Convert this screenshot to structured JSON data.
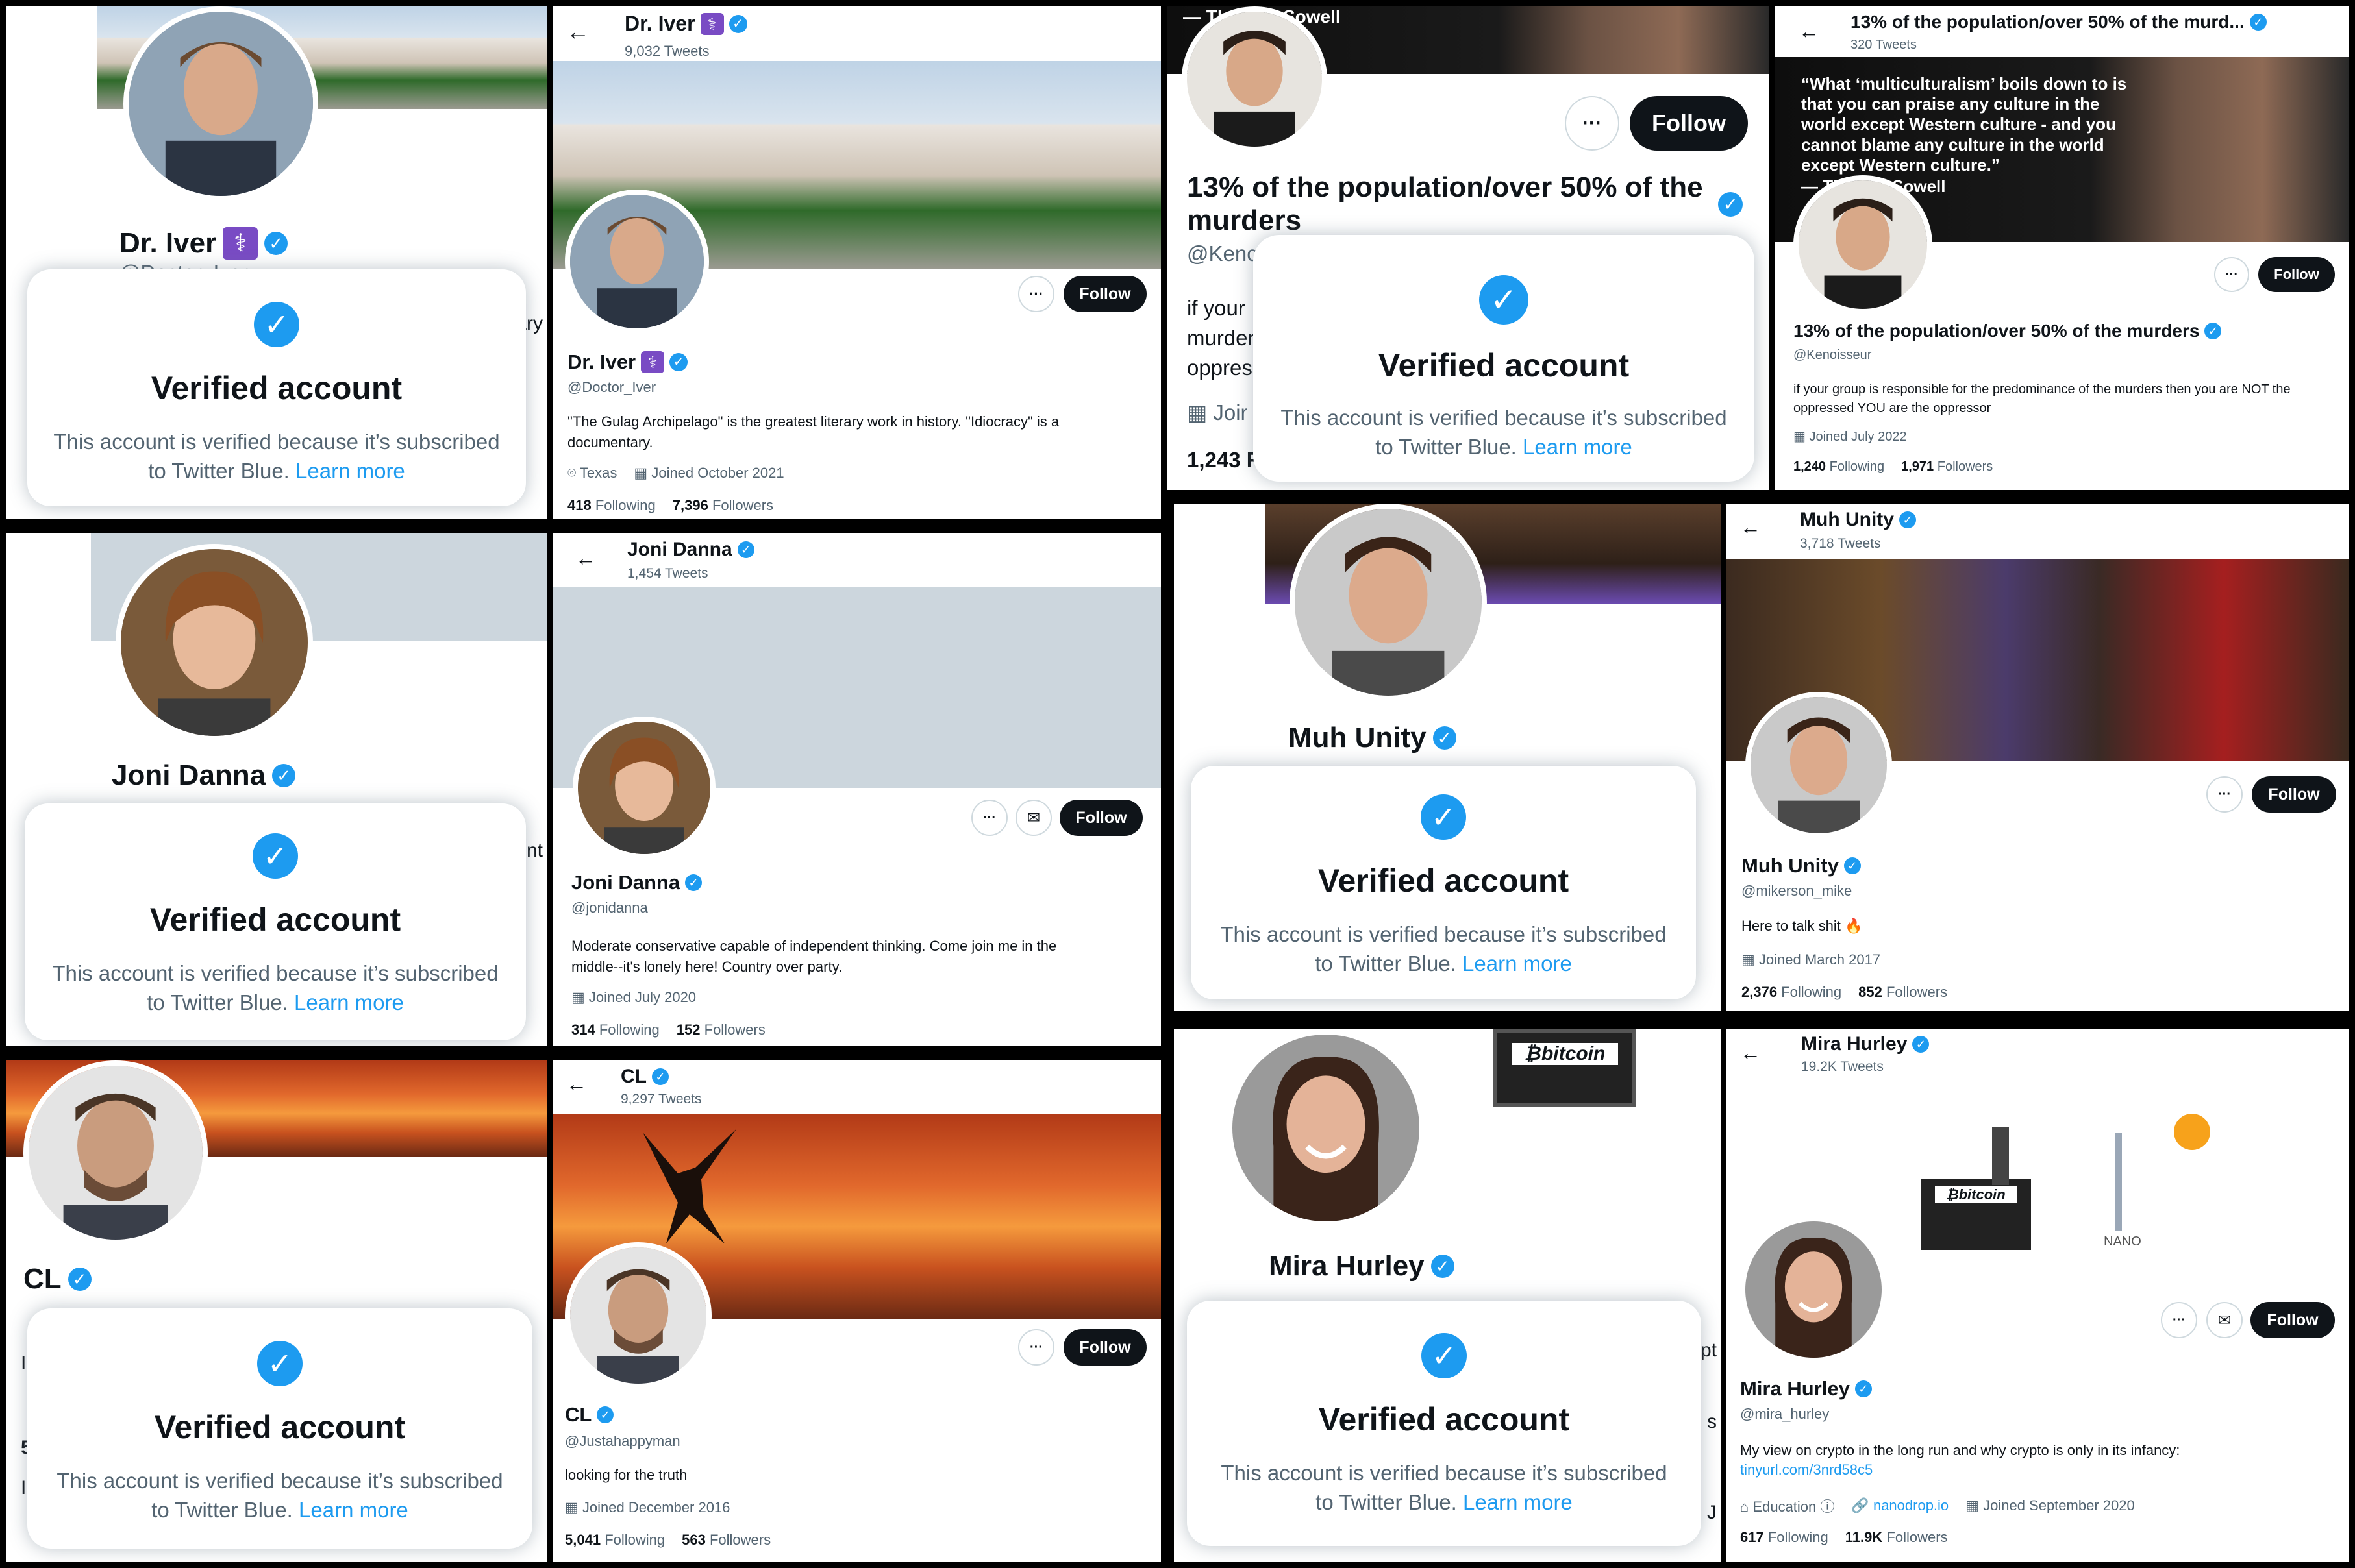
{
  "colors": {
    "accent": "#1d9bf0",
    "follow_bg": "#0f1419",
    "medical_badge": "#794bc4"
  },
  "icons": {
    "verified": "verified-badge-icon",
    "back": "back-arrow-icon",
    "more": "more-icon",
    "message": "message-icon",
    "calendar": "calendar-icon",
    "location": "location-icon",
    "link": "link-icon"
  },
  "glyphs": {
    "check": "✓",
    "back": "←",
    "more": "···",
    "mail": "✉",
    "med": "⚕",
    "pin": "⌾",
    "cal": "▦",
    "link": "🔗",
    "fire": "🔥",
    "info": "ⓘ",
    "edu": "⌂",
    "bitcoin": "₿bitcoin",
    "nano": "NANO"
  },
  "verified_card": {
    "title": "Verified account",
    "body": "This account is verified because it’s subscribed to Twitter Blue.",
    "learn_more": "Learn more"
  },
  "follow_label": "Follow",
  "labels": {
    "following": "Following",
    "followers": "Followers"
  },
  "iver": {
    "name": "Dr. Iver",
    "handle": "@Doctor_Iver",
    "tweets": "9,032 Tweets",
    "bio": "\"The Gulag Archipelago\" is the greatest literary work in history. \"Idiocracy\" is a documentary.",
    "location": "Texas",
    "joined": "Joined October 2021",
    "following": "418",
    "followers": "7,396",
    "partial_handle": "@Doctor_Iver",
    "partial_bio": "ary"
  },
  "kenoisseur": {
    "name": "13% of the population/over 50% of the murders",
    "header_name": "13% of the population/over 50% of the murd...",
    "handle": "@Kenoisseur",
    "tweets": "320 Tweets",
    "quote": "“What ‘multiculturalism’ boils down to is that you can praise any culture in the world except Western culture - and you cannot blame any culture in the world except Western culture.”",
    "quote_attr": "— Thomas Sowell",
    "top_text": "— Th",
    "top_text2": "Sowell",
    "bio": "if your group is responsible for the predominance of the murders then you are NOT the oppressed YOU are the oppressor",
    "joined": "Joined July 2022",
    "following": "1,240",
    "followers": "1,971",
    "partial_handle": "@Kenc",
    "partial_bio_1": "if your",
    "partial_bio_2": "murder",
    "partial_bio_3": "oppres",
    "partial_join": "Joir",
    "partial_following": "1,243 F"
  },
  "joni": {
    "name": "Joni Danna",
    "handle": "@jonidanna",
    "tweets": "1,454 Tweets",
    "bio": "Moderate conservative capable of independent thinking.  Come join me in the middle--it's lonely here!  Country over party.",
    "joined": "Joined July 2020",
    "following": "314",
    "followers": "152",
    "partial_bio": "ent"
  },
  "muh": {
    "name": "Muh Unity",
    "handle": "@mikerson_mike",
    "tweets": "3,718 Tweets",
    "bio": "Here to talk shit",
    "joined": "Joined March 2017",
    "following": "2,376",
    "followers": "852"
  },
  "cl": {
    "name": "CL",
    "handle": "@Justahappyman",
    "tweets": "9,297 Tweets",
    "bio": "looking for the truth",
    "joined": "Joined December 2016",
    "following": "5,041",
    "followers": "563",
    "partial_1": "I",
    "partial_2": "5",
    "partial_3": "I"
  },
  "mira": {
    "name": "Mira Hurley",
    "handle": "@mira_hurley",
    "tweets": "19.2K Tweets",
    "bio": "My view on crypto in the long run and why crypto is only in its infancy:",
    "url": "tinyurl.com/3nrd58c5",
    "category": "Education",
    "website": "nanodrop.io",
    "joined": "Joined September 2020",
    "following": "617",
    "followers": "11.9K",
    "partial_1": "pt",
    "partial_2": "I s",
    "partial_3": "J"
  }
}
